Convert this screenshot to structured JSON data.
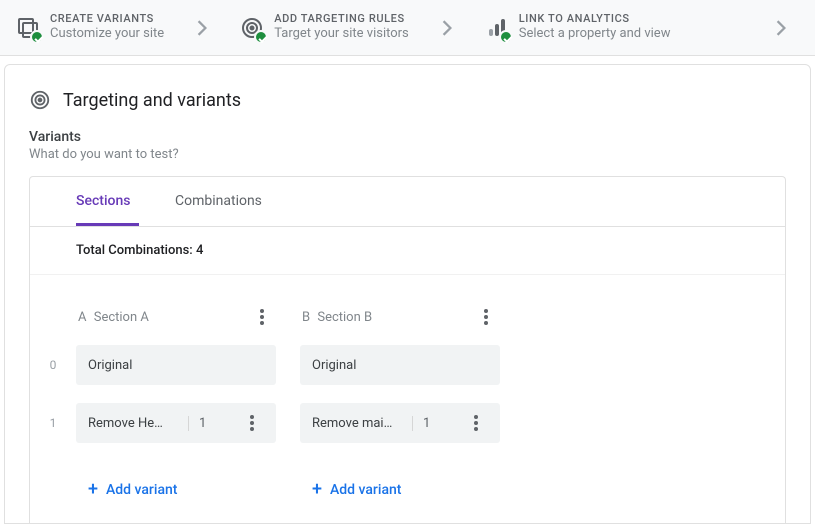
{
  "stepper": {
    "steps": [
      {
        "title": "CREATE VARIANTS",
        "sub": "Customize your site",
        "icon": "variants"
      },
      {
        "title": "ADD TARGETING RULES",
        "sub": "Target your site visitors",
        "icon": "target"
      },
      {
        "title": "LINK TO ANALYTICS",
        "sub": "Select a property and view",
        "icon": "analytics"
      }
    ]
  },
  "page": {
    "title": "Targeting and variants",
    "variants_label": "Variants",
    "variants_hint": "What do you want to test?"
  },
  "panel": {
    "tabs": {
      "sections": "Sections",
      "combinations": "Combinations",
      "active": "sections"
    },
    "total_combinations_label": "Total Combinations: ",
    "total_combinations_value": "4",
    "sections": [
      {
        "letter": "A",
        "name": "Section A",
        "rows": [
          {
            "label": "Original"
          },
          {
            "label": "Remove He…",
            "weight": "1"
          }
        ],
        "add_label": "Add variant"
      },
      {
        "letter": "B",
        "name": "Section B",
        "rows": [
          {
            "label": "Original"
          },
          {
            "label": "Remove mai…",
            "weight": "1"
          }
        ],
        "add_label": "Add variant"
      }
    ],
    "row_indices": [
      "0",
      "1"
    ]
  }
}
